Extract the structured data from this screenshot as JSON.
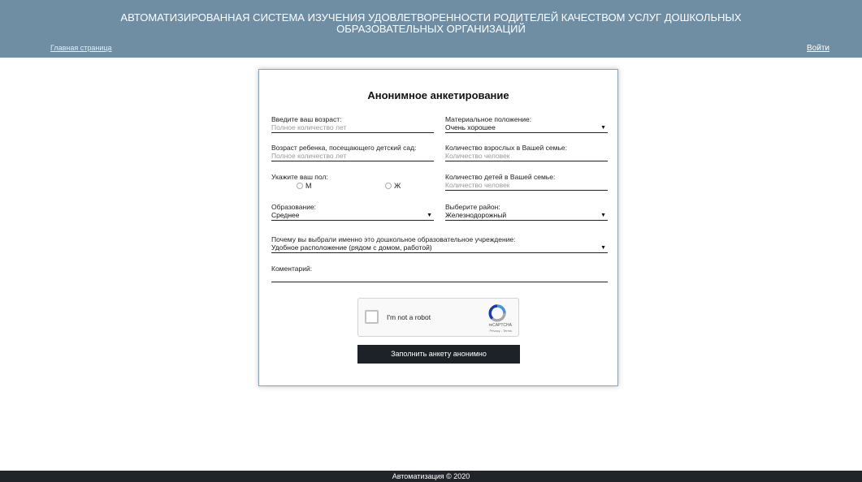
{
  "header": {
    "title_line1": "АВТОМАТИЗИРОВАННАЯ СИСТЕМА ИЗУЧЕНИЯ УДОВЛЕТВОРЕННОСТИ РОДИТЕЛЕЙ КАЧЕСТВОМ УСЛУГ ДОШКОЛЬНЫХ",
    "title_line2": "ОБРАЗОВАТЕЛЬНЫХ ОРГАНИЗАЦИЙ",
    "home_link": "Главная страница",
    "login_link": "Войти"
  },
  "form": {
    "title": "Анонимное анкетирование",
    "age": {
      "label": "Введите ваш возраст:",
      "placeholder": "Полное количество лет"
    },
    "child_age": {
      "label": "Возраст ребенка, посещающего детский сад:",
      "placeholder": "Полное количество лет"
    },
    "gender": {
      "label": "Укажите ваш пол:",
      "option_m": "М",
      "option_f": "Ж"
    },
    "education": {
      "label": "Образование:",
      "value": "Среднее"
    },
    "financial": {
      "label": "Материальное положение:",
      "value": "Очень хорошее"
    },
    "adults": {
      "label": "Количество взрослых в Вашей семье:",
      "placeholder": "Количество человек"
    },
    "children": {
      "label": "Количество детей в Вашей семье:",
      "placeholder": "Количество человек"
    },
    "district": {
      "label": "Выберите район:",
      "value": "Железнодорожный"
    },
    "reason": {
      "label": "Почему вы выбрали именно это дошкольное образовательное учреждение:",
      "value": "Удобное расположение (рядом с домом, работой)"
    },
    "comment": {
      "label": "Коментарий:",
      "value": ""
    },
    "captcha": {
      "label": "I'm not a robot",
      "brand": "reCAPTCHA",
      "terms": "Privacy - Terms"
    },
    "submit_label": "Заполнить анкету анонимно"
  },
  "footer": {
    "text": "Автоматизация © 2020"
  },
  "colors": {
    "header_bg": "#6f8ea3",
    "footer_bg": "#212529",
    "button_bg": "#1c2228"
  },
  "icons": {
    "dropdown": "chevron-down-icon",
    "captcha": "recaptcha-logo-icon"
  }
}
